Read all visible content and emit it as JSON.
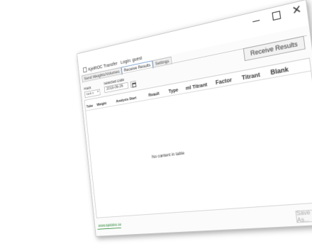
{
  "window": {
    "title": "KjelROC Transfer",
    "login": "Login: guest"
  },
  "tabs": [
    "Send Weights/Volumes",
    "Receive Results",
    "Settings"
  ],
  "active_tab": "Receive Results",
  "rack": {
    "label": "Rack",
    "value": "rack x"
  },
  "date": {
    "label": "Selected Date",
    "value": "2018-06-26"
  },
  "receive_button": "Receive Results",
  "table": {
    "columns": [
      "Tube",
      "Weight",
      "Analysis Start",
      "Result",
      "Type",
      "ml Titrant",
      "Factor",
      "Titrant",
      "Blank"
    ],
    "empty_text": "No content in table"
  },
  "footer": {
    "link": "www.kjeldine.se",
    "save_as": "Save As..."
  }
}
